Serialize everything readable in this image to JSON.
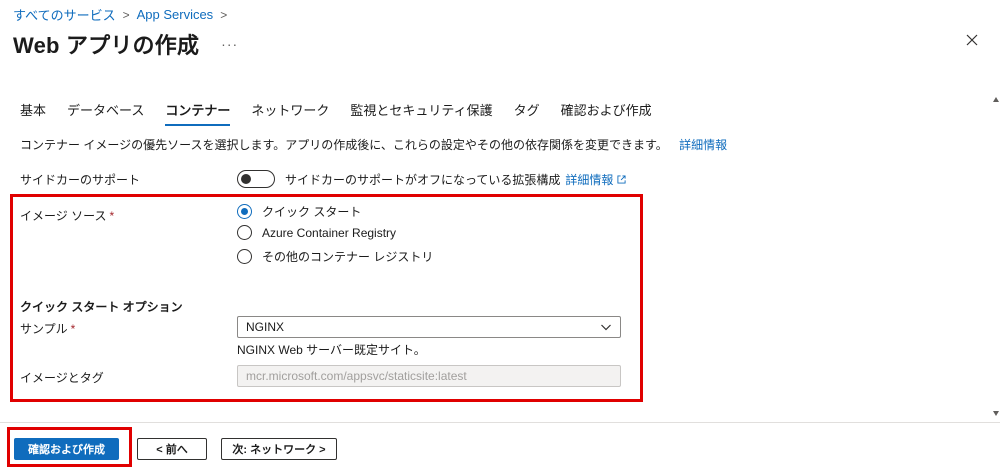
{
  "breadcrumb": {
    "items": [
      "すべてのサービス",
      "App Services"
    ]
  },
  "header": {
    "title": "Web アプリの作成",
    "more": "···"
  },
  "tabs": [
    {
      "label": "基本",
      "active": false
    },
    {
      "label": "データベース",
      "active": false
    },
    {
      "label": "コンテナー",
      "active": true
    },
    {
      "label": "ネットワーク",
      "active": false
    },
    {
      "label": "監視とセキュリティ保護",
      "active": false
    },
    {
      "label": "タグ",
      "active": false
    },
    {
      "label": "確認および作成",
      "active": false
    }
  ],
  "description": {
    "text": "コンテナー イメージの優先ソースを選択します。アプリの作成後に、これらの設定やその他の依存関係を変更できます。",
    "link": "詳細情報"
  },
  "sidecar": {
    "label": "サイドカーのサポート",
    "toggle_on": false,
    "status": "サイドカーのサポートがオフになっている拡張構成",
    "link": "詳細情報"
  },
  "image_source": {
    "label": "イメージ ソース",
    "required": "*",
    "options": [
      {
        "label": "クイック スタート",
        "checked": true
      },
      {
        "label": "Azure Container Registry",
        "checked": false
      },
      {
        "label": "その他のコンテナー レジストリ",
        "checked": false
      }
    ]
  },
  "quickstart": {
    "heading": "クイック スタート オプション",
    "sample": {
      "label": "サンプル",
      "required": "*",
      "value": "NGINX",
      "help": "NGINX Web サーバー既定サイト。"
    },
    "image_tag": {
      "label": "イメージとタグ",
      "value": "mcr.microsoft.com/appsvc/staticsite:latest"
    }
  },
  "footer": {
    "review_create": "確認および作成",
    "prev": "< 前へ",
    "next": "次: ネットワーク >"
  },
  "colors": {
    "accent": "#0f6cbd",
    "highlight": "#e00000",
    "required": "#a4262c"
  }
}
